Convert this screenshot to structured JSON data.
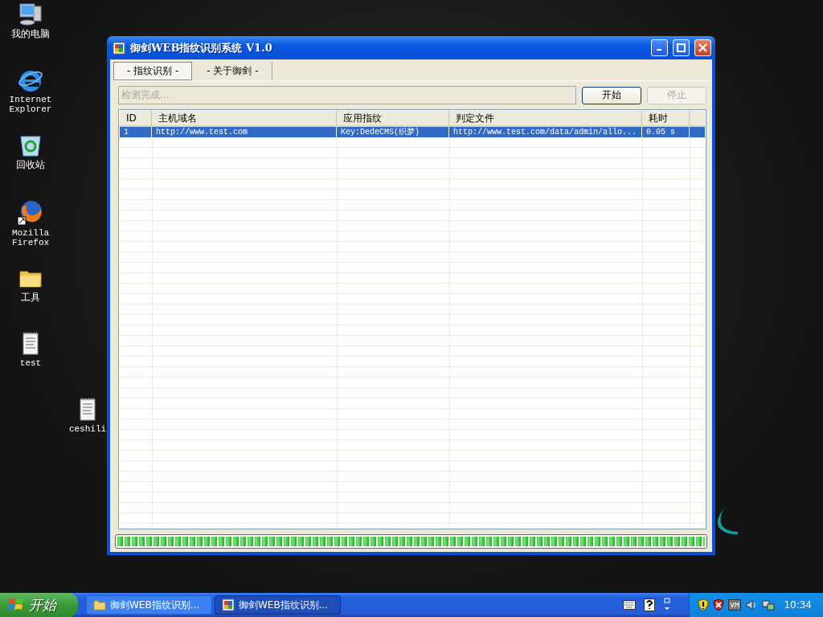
{
  "desktop_icons": [
    {
      "kind": "computer",
      "label": "我的电脑"
    },
    {
      "kind": "browser",
      "label": "Internet Explorer"
    },
    {
      "kind": "recycle",
      "label": "回收站"
    },
    {
      "kind": "firefox",
      "label": "Mozilla Firefox"
    },
    {
      "kind": "folder",
      "label": "工具"
    },
    {
      "kind": "notepad",
      "label": "test"
    },
    {
      "kind": "notepad",
      "label": "ceshili"
    }
  ],
  "window": {
    "title": "御剑WEB指纹识别系统 V1.0",
    "tabs": [
      {
        "label": "- 指纹识别 -",
        "selected": true
      },
      {
        "label": "- 关于御剑 -",
        "selected": false
      }
    ],
    "status_field": {
      "value": "检测完成..."
    },
    "buttons": [
      {
        "label": "开始",
        "disabled": false
      },
      {
        "label": "停止",
        "disabled": true
      }
    ],
    "table": {
      "columns": [
        "ID",
        "主机域名",
        "应用指纹",
        "判定文件",
        "耗时"
      ],
      "rows": [
        {
          "cells": [
            "1",
            "http://www.test.com",
            "Key:DedeCMS(织梦)",
            "http://www.test.com/data/admin/allo...",
            "0.05 s"
          ],
          "selected": true
        }
      ]
    },
    "progress": {
      "level": 1
    }
  },
  "taskbar": {
    "start": "开始",
    "tasks": [
      {
        "kind": "folder",
        "label": "御剑WEB指纹识别...",
        "selected": false
      },
      {
        "kind": "app",
        "label": "御剑WEB指纹识别...",
        "selected": true
      }
    ],
    "clock": "10:34"
  }
}
